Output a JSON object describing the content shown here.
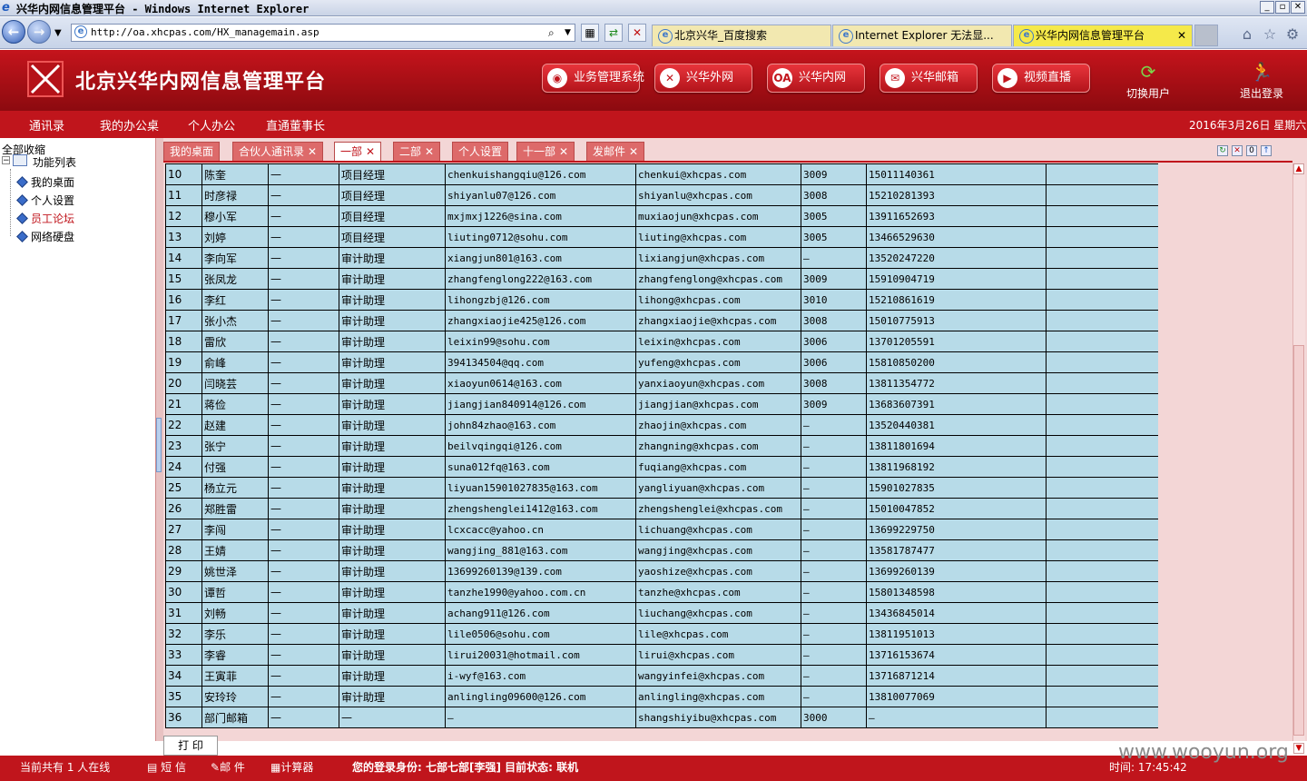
{
  "browser": {
    "title": "兴华内网信息管理平台 - Windows Internet Explorer",
    "address": "http://oa.xhcpas.com/HX_managemain.asp",
    "tabs": [
      {
        "label": "北京兴华_百度搜索"
      },
      {
        "label": "Internet Explorer 无法显..."
      },
      {
        "label": "兴华内网信息管理平台"
      }
    ]
  },
  "header": {
    "title": "北京兴华内网信息管理平台",
    "buttons": [
      {
        "label": "业务管理系统"
      },
      {
        "label": "兴华外网"
      },
      {
        "label": "兴华内网"
      },
      {
        "label": "兴华邮箱"
      },
      {
        "label": "视频直播"
      }
    ],
    "switch_user": "切换用户",
    "logout": "退出登录"
  },
  "menu": {
    "items": [
      "通讯录",
      "我的办公桌",
      "个人办公",
      "直通董事长"
    ],
    "date": "2016年3月26日 星期六"
  },
  "sidebar": {
    "collapse_all": "全部收缩",
    "root": "功能列表",
    "items": [
      "我的桌面",
      "个人设置",
      "员工论坛",
      "网络硬盘"
    ]
  },
  "content_tabs": [
    {
      "label": "我的桌面"
    },
    {
      "label": "合伙人通讯录"
    },
    {
      "label": "一部"
    },
    {
      "label": "二部"
    },
    {
      "label": "个人设置"
    },
    {
      "label": "十一部"
    },
    {
      "label": "发邮件"
    }
  ],
  "table": {
    "rows": [
      [
        "10",
        "陈奎",
        "—",
        "项目经理",
        "chenkuishangqiu@126.com",
        "chenkui@xhcpas.com",
        "3009",
        "15011140361",
        ""
      ],
      [
        "11",
        "时彦禄",
        "—",
        "项目经理",
        "shiyanlu07@126.com",
        "shiyanlu@xhcpas.com",
        "3008",
        "15210281393",
        ""
      ],
      [
        "12",
        "穆小军",
        "—",
        "项目经理",
        "mxjmxj1226@sina.com",
        "muxiaojun@xhcpas.com",
        "3005",
        "13911652693",
        ""
      ],
      [
        "13",
        "刘婷",
        "—",
        "项目经理",
        "liuting0712@sohu.com",
        "liuting@xhcpas.com",
        "3005",
        "13466529630",
        ""
      ],
      [
        "14",
        "李向军",
        "—",
        "审计助理",
        "xiangjun801@163.com",
        "lixiangjun@xhcpas.com",
        "—",
        "13520247220",
        ""
      ],
      [
        "15",
        "张凤龙",
        "—",
        "审计助理",
        "zhangfenglong222@163.com",
        "zhangfenglong@xhcpas.com",
        "3009",
        "15910904719",
        ""
      ],
      [
        "16",
        "李红",
        "—",
        "审计助理",
        "lihongzbj@126.com",
        "lihong@xhcpas.com",
        "3010",
        "15210861619",
        ""
      ],
      [
        "17",
        "张小杰",
        "—",
        "审计助理",
        "zhangxiaojie425@126.com",
        "zhangxiaojie@xhcpas.com",
        "3008",
        "15010775913",
        ""
      ],
      [
        "18",
        "雷欣",
        "—",
        "审计助理",
        "leixin99@sohu.com",
        "leixin@xhcpas.com",
        "3006",
        "13701205591",
        ""
      ],
      [
        "19",
        "俞峰",
        "—",
        "审计助理",
        "394134504@qq.com",
        "yufeng@xhcpas.com",
        "3006",
        "15810850200",
        ""
      ],
      [
        "20",
        "闫晓芸",
        "—",
        "审计助理",
        "xiaoyun0614@163.com",
        "yanxiaoyun@xhcpas.com",
        "3008",
        "13811354772",
        ""
      ],
      [
        "21",
        "蒋俭",
        "—",
        "审计助理",
        "jiangjian840914@126.com",
        "jiangjian@xhcpas.com",
        "3009",
        "13683607391",
        ""
      ],
      [
        "22",
        "赵建",
        "—",
        "审计助理",
        "john84zhao@163.com",
        "zhaojin@xhcpas.com",
        "—",
        "13520440381",
        ""
      ],
      [
        "23",
        "张宁",
        "—",
        "审计助理",
        "beilvqingqi@126.com",
        "zhangning@xhcpas.com",
        "—",
        "13811801694",
        ""
      ],
      [
        "24",
        "付强",
        "—",
        "审计助理",
        "suna012fq@163.com",
        "fuqiang@xhcpas.com",
        "—",
        "13811968192",
        ""
      ],
      [
        "25",
        "杨立元",
        "—",
        "审计助理",
        "liyuan15901027835@163.com",
        "yangliyuan@xhcpas.com",
        "—",
        "15901027835",
        ""
      ],
      [
        "26",
        "郑胜雷",
        "—",
        "审计助理",
        "zhengshenglei1412@163.com",
        "zhengshenglei@xhcpas.com",
        "—",
        "15010047852",
        ""
      ],
      [
        "27",
        "李闯",
        "—",
        "审计助理",
        "lcxcacc@yahoo.cn",
        "lichuang@xhcpas.com",
        "—",
        "13699229750",
        ""
      ],
      [
        "28",
        "王婧",
        "—",
        "审计助理",
        "wangjing_881@163.com",
        "wangjing@xhcpas.com",
        "—",
        "13581787477",
        ""
      ],
      [
        "29",
        "姚世泽",
        "—",
        "审计助理",
        "13699260139@139.com",
        "yaoshize@xhcpas.com",
        "—",
        "13699260139",
        ""
      ],
      [
        "30",
        "谭哲",
        "—",
        "审计助理",
        "tanzhe1990@yahoo.com.cn",
        "tanzhe@xhcpas.com",
        "—",
        "15801348598",
        ""
      ],
      [
        "31",
        "刘畅",
        "—",
        "审计助理",
        "achang911@126.com",
        "liuchang@xhcpas.com",
        "—",
        "13436845014",
        ""
      ],
      [
        "32",
        "李乐",
        "—",
        "审计助理",
        "lile0506@sohu.com",
        "lile@xhcpas.com",
        "—",
        "13811951013",
        ""
      ],
      [
        "33",
        "李睿",
        "—",
        "审计助理",
        "lirui20031@hotmail.com",
        "lirui@xhcpas.com",
        "—",
        "13716153674",
        ""
      ],
      [
        "34",
        "王寅菲",
        "—",
        "审计助理",
        "i-wyf@163.com",
        "wangyinfei@xhcpas.com",
        "—",
        "13716871214",
        ""
      ],
      [
        "35",
        "安玲玲",
        "—",
        "审计助理",
        "anlingling09600@126.com",
        "anlingling@xhcpas.com",
        "—",
        "13810077069",
        ""
      ],
      [
        "36",
        "部门邮箱",
        "—",
        "—",
        "—",
        "shangshiyibu@xhcpas.com",
        "3000",
        "—",
        ""
      ]
    ]
  },
  "print_label": "打 印",
  "status": {
    "online": "当前共有 1 人在线",
    "sms": "短 信",
    "mail": "邮 件",
    "calculator": "计算器",
    "identity": "您的登录身份: 七部七部[李强]  目前状态: 联机",
    "time": "时间: 17:45:42"
  },
  "watermark": "www.wooyun.org"
}
